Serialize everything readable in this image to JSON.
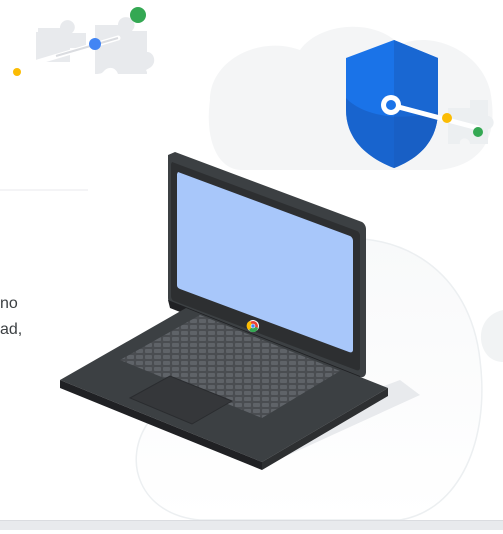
{
  "content": {
    "text_fragments": [
      "no",
      "ad,"
    ]
  },
  "colors": {
    "google_blue": "#4285f4",
    "google_green": "#34a853",
    "google_yellow": "#fbbc04",
    "google_red": "#ea4335",
    "shield_blue": "#1a73e8",
    "laptop_body": "#3c4043",
    "laptop_screen": "#a8c7fa",
    "cloud": "#f1f3f4"
  },
  "icons": {
    "puzzle": "puzzle-piece-icon",
    "shield": "security-shield-icon",
    "key": "key-icon",
    "chrome": "chrome-logo-icon",
    "laptop": "laptop-icon"
  }
}
